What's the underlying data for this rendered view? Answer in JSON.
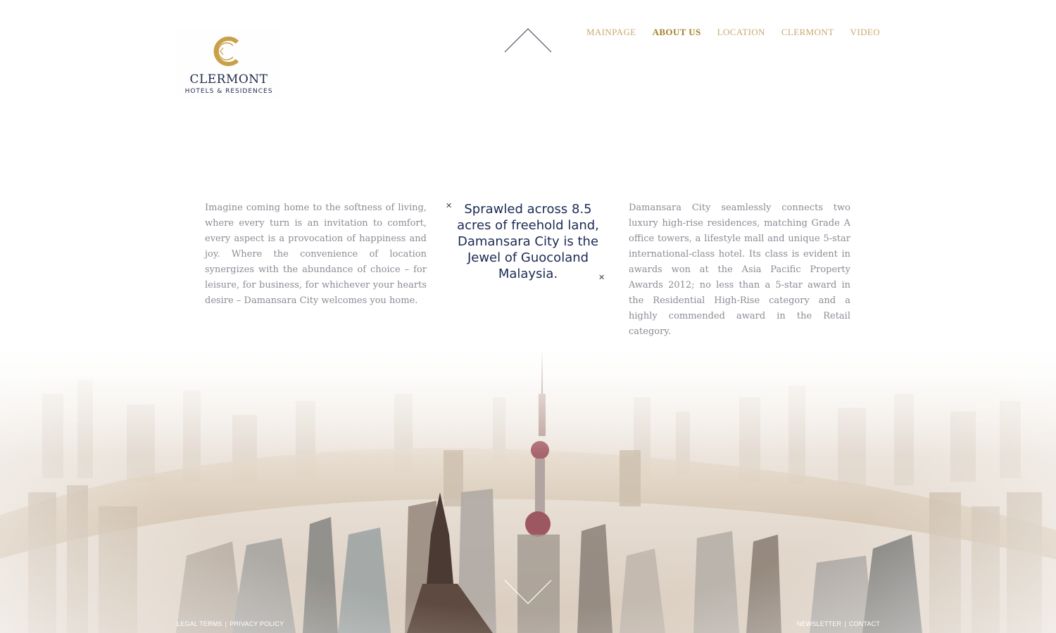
{
  "logo": {
    "brand": "CLERMONT",
    "subtitle": "HOTELS & RESIDENCES",
    "gold": "#c9a04a",
    "navy": "#1d2a4a"
  },
  "nav": {
    "items": [
      {
        "label": "MAINPAGE",
        "active": false
      },
      {
        "label": "ABOUT US",
        "active": true
      },
      {
        "label": "LOCATION",
        "active": false
      },
      {
        "label": "CLERMONT",
        "active": false
      },
      {
        "label": "VIDEO",
        "active": false
      }
    ]
  },
  "content": {
    "left_text": "Imagine coming home to the softness of living, where every turn is an invitation to comfort, every aspect is a provocation of happiness and joy. Where the convenience of location synergizes with the abundance of choice – for leisure, for business, for whichever your hearts desire – Damansara City welcomes you home.",
    "quote": "Sprawled across 8.5 acres of freehold land, Damansara City is the Jewel of Guocoland Malaysia.",
    "right_text": "Damansara City seamlessly connects two luxury high-rise residences, matching Grade A office towers, a lifestyle mall and unique 5-star international-class hotel. Its class is evident in awards won at the Asia Pacific Property Awards 2012; no less than a 5-star award in the Residential High-Rise category and a highly commended award in the Retail category."
  },
  "icons": {
    "scroll_up": "chevron-up-icon",
    "scroll_down": "chevron-down-icon",
    "quote_mark": "cross-icon"
  },
  "footer": {
    "legal": "LEGAL TERMS",
    "privacy": "PRIVACY POLICY",
    "newsletter": "NEWSLETTER",
    "contact": "CONTACT",
    "separator": "|"
  },
  "colors": {
    "nav_text": "#c9a96e",
    "nav_active": "#a4802b",
    "body_text": "#8a8c94",
    "quote_text": "#1b2a52"
  }
}
